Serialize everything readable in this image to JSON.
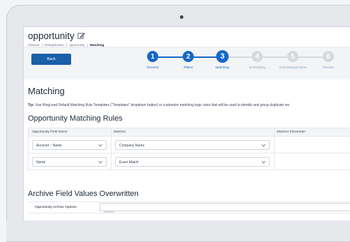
{
  "page": {
    "title": "opportunity",
    "edit_icon": "edit-icon",
    "breadcrumb": [
      "Cleanse",
      "Deduplication",
      "opportunity",
      "Matching"
    ]
  },
  "toolbar": {
    "back_label": "Back"
  },
  "steps": [
    {
      "number": "1",
      "label": "General",
      "state": "done"
    },
    {
      "number": "2",
      "label": "Filters",
      "state": "done"
    },
    {
      "number": "3",
      "label": "Matching",
      "state": "current"
    },
    {
      "number": "4",
      "label": "Scheduling",
      "state": "todo"
    },
    {
      "number": "5",
      "label": "Test Deduplication",
      "state": "todo"
    },
    {
      "number": "6",
      "label": "Review",
      "state": "todo"
    }
  ],
  "main": {
    "heading": "Matching",
    "tip_prefix": "Tip:",
    "tip_text": " Use RingLead Default Matching Rule Templates (\"Templates\" dropdown button) or customize matching logic rules that will be used to identify and group duplicate rec",
    "rules_heading": "Opportunity Matching Rules",
    "table": {
      "headers": [
        "Opportunity Field Name",
        "Matcher",
        "Matcher Parameter"
      ],
      "rows": [
        {
          "field": "Account :: Name",
          "matcher": "Company Name"
        },
        {
          "field": "Name",
          "matcher": "Exact Match"
        }
      ]
    },
    "archive_heading": "Archive Field Values Overwritten",
    "archive_label": "Opportunity Archive Options",
    "archive_placeholder": "Select..."
  },
  "colors": {
    "accent": "#1668c7",
    "button": "#1a5fa8",
    "step_inactive": "#d6d9de"
  }
}
